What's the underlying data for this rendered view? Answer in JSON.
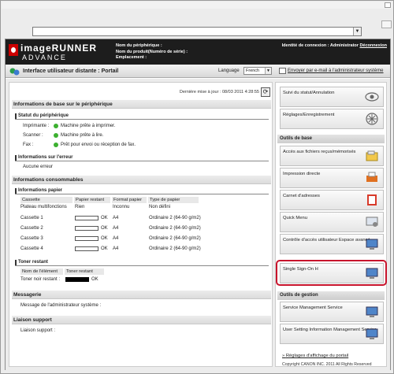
{
  "header": {
    "brand_line1": "imageRUNNER",
    "brand_line2": "ADVANCE",
    "device_name_label": "Nom du périphérique :",
    "product_name_label": "Nom du produit(Numéro de série) :",
    "location_label": "Emplacement :",
    "login_label": "Identité de connexion : Administrator",
    "logout_label": "Déconnexion"
  },
  "titlebar": {
    "title": "Interface utilisateur distante : Portail",
    "language_label": "Language",
    "language_value": "French",
    "mail_link": "Envoyer par e-mail à l'administrateur système"
  },
  "left": {
    "last_update": "Dernière mise à jour : 08/03 2011 4:28:55",
    "basic_info_title": "Informations de base sur le périphérique",
    "status_title": "Statut du périphérique",
    "status_rows": [
      {
        "label": "Imprimante :",
        "value": "Machine prête à imprimer."
      },
      {
        "label": "Scanner :",
        "value": "Machine prête à lire."
      },
      {
        "label": "Fax :",
        "value": "Prêt pour envoi ou réception de fax."
      }
    ],
    "error_title": "Informations sur l'erreur",
    "error_value": "Aucune erreur",
    "consumables_title": "Informations consommables",
    "paper_title": "Informations papier",
    "paper_headers": [
      "Cassette",
      "Papier restant",
      "Format papier",
      "Type de papier"
    ],
    "paper_rows": [
      {
        "name": "Plateau multifonctions",
        "remaining": "Rien",
        "format": "Inconnu",
        "type": "Non défini",
        "bar": false
      },
      {
        "name": "Cassette 1",
        "remaining": "OK",
        "format": "A4",
        "type": "Ordinaire 2 (64-90 g/m2)",
        "bar": true
      },
      {
        "name": "Cassette 2",
        "remaining": "OK",
        "format": "A4",
        "type": "Ordinaire 2 (64-90 g/m2)",
        "bar": true
      },
      {
        "name": "Cassette 3",
        "remaining": "OK",
        "format": "A4",
        "type": "Ordinaire 2 (64-90 g/m2)",
        "bar": true
      },
      {
        "name": "Cassette 4",
        "remaining": "OK",
        "format": "A4",
        "type": "Ordinaire 2 (64-90 g/m2)",
        "bar": true
      }
    ],
    "toner_title": "Toner restant",
    "toner_headers": [
      "Nom de l'élément",
      "Toner restant"
    ],
    "toner_row": {
      "name": "Toner noir restant :",
      "value": "OK"
    },
    "messaging_title": "Messagerie",
    "messaging_value": "Message de l'administrateur système :",
    "support_title": "Liaison support",
    "support_value": "Liaison support :"
  },
  "right": {
    "top_buttons": [
      "Suivi du statut/Annulation",
      "Réglages/Enregistrement"
    ],
    "tools_title": "Outils de base",
    "tools": [
      "Accès aux fichiers reçus/mémorisés",
      "Impression directe",
      "Carnet d'adresses",
      "Quick Menu",
      "Contrôle d'accès utilisateur Espace avancé",
      "Single Sign-On H"
    ],
    "mgmt_title": "Outils de gestion",
    "mgmt": [
      "Service Management Service",
      "User Setting Information Management Service"
    ],
    "portal_link": "Réglages d'affichage du portail",
    "copyright": "Copyright CANON INC. 2011 All Rights Reserved"
  },
  "colors": {
    "highlight": "#c8142c",
    "header_bg": "#1d1d1d",
    "status_ok": "#3cb030"
  }
}
